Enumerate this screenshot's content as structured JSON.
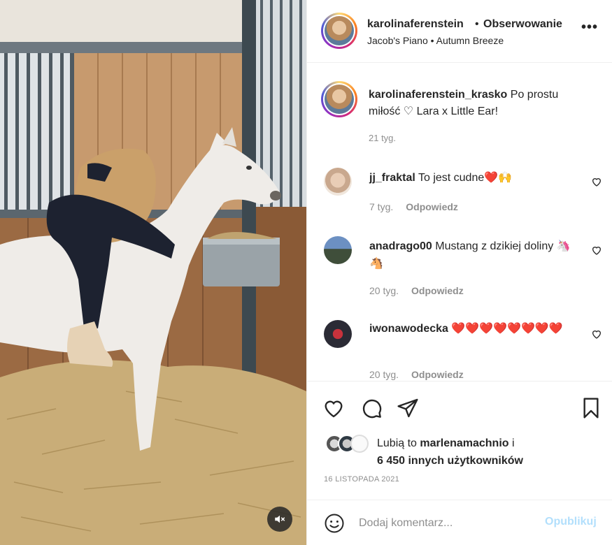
{
  "header": {
    "username": "karolinaferenstein",
    "separator": "•",
    "follow_label": "Obserwowanie",
    "audio": "Jacob's Piano • Autumn Breeze",
    "more_icon": "more-horizontal-icon"
  },
  "caption": {
    "username": "karolinaferenstein_krasko",
    "text": "Po prostu miłość ♡ Lara x Little Ear!",
    "time": "21 tyg."
  },
  "comments": [
    {
      "username": "jj_fraktal",
      "text": "To jest cudne❤️🙌",
      "time": "7 tyg.",
      "reply": "Odpowiedz"
    },
    {
      "username": "anadrago00",
      "text": "Mustang z dzikiej doliny 🦄🐴",
      "time": "20 tyg.",
      "reply": "Odpowiedz"
    },
    {
      "username": "iwonawodecka",
      "text": "❤️❤️❤️❤️❤️❤️❤️❤️",
      "time": "20 tyg.",
      "reply": "Odpowiedz"
    }
  ],
  "actions": {
    "like_icon": "heart-icon",
    "comment_icon": "comment-icon",
    "share_icon": "send-icon",
    "save_icon": "bookmark-icon"
  },
  "likes": {
    "prefix": "Lubią to",
    "user": "marlenamachnio",
    "connector": "i",
    "others": "6 450 innych użytkowników"
  },
  "post_date": "16 LISTOPADA 2021",
  "add_comment": {
    "placeholder": "Dodaj komentarz...",
    "publish_label": "Opublikuj",
    "emoji_icon": "smiley-icon"
  },
  "media": {
    "mute_icon": "muted-speaker-icon"
  },
  "colors": {
    "link_disabled": "#b2dffc",
    "meta_gray": "#8e8e8e",
    "text": "#262626",
    "heart_red": "#ed1c3c"
  }
}
